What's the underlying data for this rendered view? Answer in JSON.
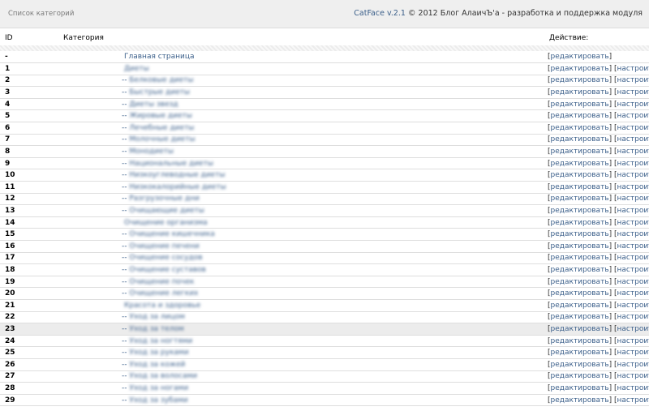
{
  "header": {
    "title": "Список категорий",
    "product": "CatFace v.2.1",
    "copyright": "© 2012 Блог АлаичЪ'а - разработка и поддержка модуля"
  },
  "columns": {
    "id": "ID",
    "category": "Категория",
    "action": "Действие:"
  },
  "actions": {
    "edit": "редактировать",
    "configure": "настроить"
  },
  "rows": [
    {
      "id": "-",
      "prefix": "",
      "name": "Главная страница",
      "blurred": false,
      "configure": false
    },
    {
      "id": "1",
      "prefix": "",
      "name": "Диеты",
      "blurred": true,
      "configure": true
    },
    {
      "id": "2",
      "prefix": "-- ",
      "name": "Белковые диеты",
      "blurred": true,
      "configure": true
    },
    {
      "id": "3",
      "prefix": "-- ",
      "name": "Быстрые диеты",
      "blurred": true,
      "configure": true
    },
    {
      "id": "4",
      "prefix": "-- ",
      "name": "Диеты звезд",
      "blurred": true,
      "configure": true
    },
    {
      "id": "5",
      "prefix": "-- ",
      "name": "Жировые диеты",
      "blurred": true,
      "configure": true
    },
    {
      "id": "6",
      "prefix": "-- ",
      "name": "Лечебные диеты",
      "blurred": true,
      "configure": true
    },
    {
      "id": "7",
      "prefix": "-- ",
      "name": "Молочные диеты",
      "blurred": true,
      "configure": true
    },
    {
      "id": "8",
      "prefix": "-- ",
      "name": "Монодиеты",
      "blurred": true,
      "configure": true
    },
    {
      "id": "9",
      "prefix": "-- ",
      "name": "Национальные диеты",
      "blurred": true,
      "configure": true
    },
    {
      "id": "10",
      "prefix": "-- ",
      "name": "Низкоуглеводные диеты",
      "blurred": true,
      "configure": true
    },
    {
      "id": "11",
      "prefix": "-- ",
      "name": "Низкокалорийные диеты",
      "blurred": true,
      "configure": true
    },
    {
      "id": "12",
      "prefix": "-- ",
      "name": "Разгрузочные дни",
      "blurred": true,
      "configure": true
    },
    {
      "id": "13",
      "prefix": "-- ",
      "name": "Очищающие диеты",
      "blurred": true,
      "configure": true
    },
    {
      "id": "14",
      "prefix": "",
      "name": "Очищение организма",
      "blurred": true,
      "configure": true
    },
    {
      "id": "15",
      "prefix": "-- ",
      "name": "Очищение кишечника",
      "blurred": true,
      "configure": true
    },
    {
      "id": "16",
      "prefix": "-- ",
      "name": "Очищение печени",
      "blurred": true,
      "configure": true
    },
    {
      "id": "17",
      "prefix": "-- ",
      "name": "Очищение сосудов",
      "blurred": true,
      "configure": true
    },
    {
      "id": "18",
      "prefix": "-- ",
      "name": "Очищение суставов",
      "blurred": true,
      "configure": true
    },
    {
      "id": "19",
      "prefix": "-- ",
      "name": "Очищение почек",
      "blurred": true,
      "configure": true
    },
    {
      "id": "20",
      "prefix": "-- ",
      "name": "Очищение легких",
      "blurred": true,
      "configure": true
    },
    {
      "id": "21",
      "prefix": "",
      "name": "Красота и здоровье",
      "blurred": true,
      "configure": true
    },
    {
      "id": "22",
      "prefix": "-- ",
      "name": "Уход за лицом",
      "blurred": true,
      "configure": true
    },
    {
      "id": "23",
      "prefix": "-- ",
      "name": "Уход за телом",
      "blurred": true,
      "configure": true,
      "highlight": true
    },
    {
      "id": "24",
      "prefix": "-- ",
      "name": "Уход за ногтями",
      "blurred": true,
      "configure": true
    },
    {
      "id": "25",
      "prefix": "-- ",
      "name": "Уход за руками",
      "blurred": true,
      "configure": true
    },
    {
      "id": "26",
      "prefix": "-- ",
      "name": "Уход за кожей",
      "blurred": true,
      "configure": true
    },
    {
      "id": "27",
      "prefix": "-- ",
      "name": "Уход за волосами",
      "blurred": true,
      "configure": true
    },
    {
      "id": "28",
      "prefix": "-- ",
      "name": "Уход за ногами",
      "blurred": true,
      "configure": true
    },
    {
      "id": "29",
      "prefix": "-- ",
      "name": "Уход за зубами",
      "blurred": true,
      "configure": true
    }
  ]
}
